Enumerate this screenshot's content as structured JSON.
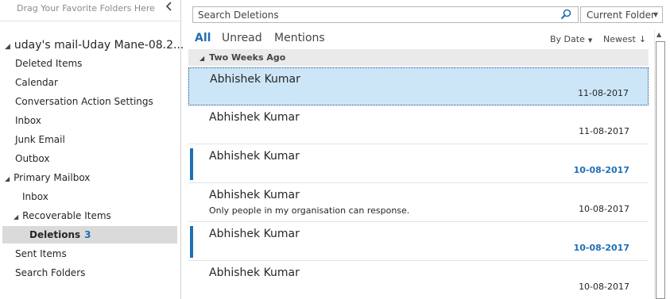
{
  "folder_pane": {
    "favorites_hint": "Drag Your Favorite Folders Here",
    "account": "uday's mail-Uday Mane-08.2...",
    "folders": [
      {
        "label": "Deleted Items"
      },
      {
        "label": "Calendar"
      },
      {
        "label": "Conversation Action Settings"
      },
      {
        "label": "Inbox"
      },
      {
        "label": "Junk Email"
      },
      {
        "label": "Outbox"
      },
      {
        "label": "Primary Mailbox"
      },
      {
        "label": "Inbox"
      },
      {
        "label": "Recoverable Items"
      },
      {
        "label": "Deletions",
        "count": "3"
      },
      {
        "label": "Sent Items"
      },
      {
        "label": "Search Folders"
      }
    ]
  },
  "search": {
    "placeholder": "Search Deletions",
    "scope": "Current Folder"
  },
  "tabs": {
    "all": "All",
    "unread": "Unread",
    "mentions": "Mentions"
  },
  "sort": {
    "by": "By Date",
    "order": "Newest"
  },
  "message_list": {
    "group": "Two Weeks Ago",
    "messages": [
      {
        "sender": "Abhishek Kumar",
        "preview": "",
        "date": "11-08-2017"
      },
      {
        "sender": "Abhishek Kumar",
        "preview": "",
        "date": "11-08-2017"
      },
      {
        "sender": "Abhishek Kumar",
        "preview": "",
        "date": "10-08-2017"
      },
      {
        "sender": "Abhishek Kumar",
        "preview": "Only people in my organisation can response.",
        "date": "10-08-2017"
      },
      {
        "sender": "Abhishek Kumar",
        "preview": "",
        "date": "10-08-2017"
      },
      {
        "sender": "Abhishek Kumar",
        "preview": "",
        "date": "10-08-2017"
      }
    ]
  },
  "colors": {
    "accent": "#1f6fb5",
    "selected_row": "#cde6f7",
    "selected_folder": "#dadada"
  }
}
